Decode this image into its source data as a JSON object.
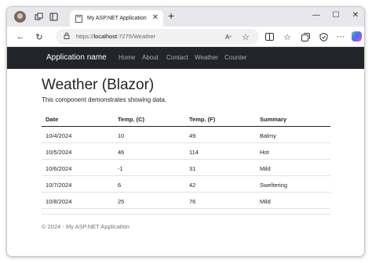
{
  "browser": {
    "tab_title": "My ASP.NET Application",
    "address": {
      "scheme": "https://",
      "host": "localhost",
      "path": ":7275/Weather"
    }
  },
  "app": {
    "brand": "Application name",
    "nav": [
      "Home",
      "About",
      "Contact",
      "Weather",
      "Counter"
    ]
  },
  "page": {
    "title": "Weather (Blazor)",
    "description": "This component demonstrates showing data."
  },
  "table": {
    "headers": [
      "Date",
      "Temp. (C)",
      "Temp. (F)",
      "Summary"
    ],
    "rows": [
      [
        "10/4/2024",
        "10",
        "49",
        "Balmy"
      ],
      [
        "10/5/2024",
        "46",
        "114",
        "Hot"
      ],
      [
        "10/6/2024",
        "-1",
        "31",
        "Mild"
      ],
      [
        "10/7/2024",
        "6",
        "42",
        "Sweltering"
      ],
      [
        "10/8/2024",
        "25",
        "76",
        "Mild"
      ]
    ]
  },
  "footer": "© 2024 - My ASP.NET Application",
  "icons": {
    "profile": "profile-avatar",
    "workspaces": "workspaces-icon",
    "tab_actions": "tab-actions-icon",
    "back": "back-arrow-icon",
    "refresh": "refresh-icon",
    "site_info": "site-info-icon",
    "read_aloud": "read-aloud-icon",
    "favorite": "favorite-star-icon",
    "split_screen": "split-screen-icon",
    "favorites": "favorites-icon",
    "collections": "collections-icon",
    "extensions": "browser-essentials-icon",
    "more": "more-menu-icon",
    "copilot": "copilot-icon"
  }
}
